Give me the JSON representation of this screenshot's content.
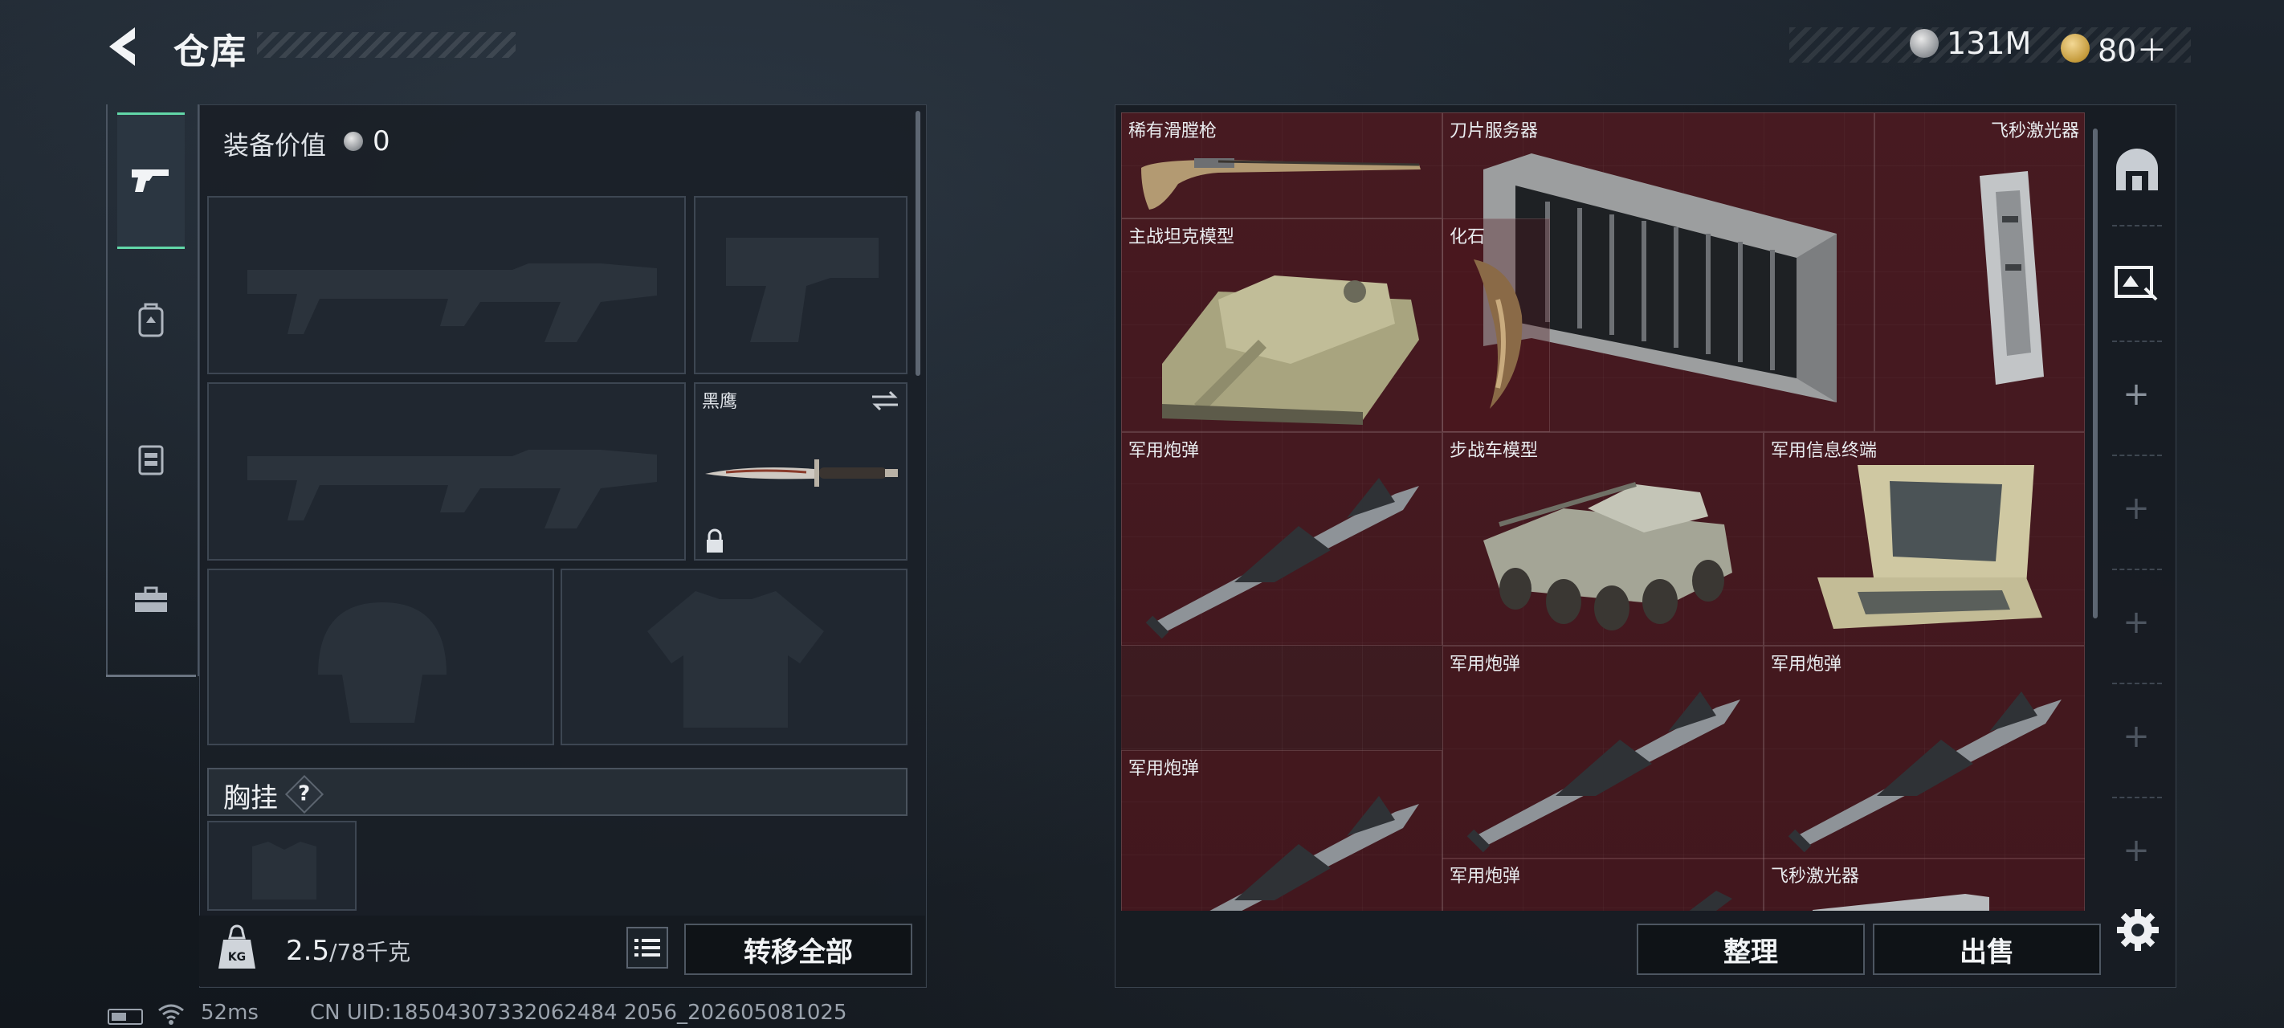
{
  "header": {
    "title": "仓库"
  },
  "currency": {
    "silver": "131M",
    "gold": "80＋"
  },
  "left_tabs": [
    {
      "icon": "pistol-icon",
      "active": true
    },
    {
      "icon": "backpack-icon",
      "active": false
    },
    {
      "icon": "vest-icon",
      "active": false
    },
    {
      "icon": "toolbox-icon",
      "active": false
    }
  ],
  "equipment": {
    "value_label": "装备价值",
    "value": "0",
    "slots": [
      {
        "name": "",
        "item": "rifle-placeholder"
      },
      {
        "name": "",
        "item": "pistol-placeholder"
      },
      {
        "name": "",
        "item": "rifle-placeholder"
      },
      {
        "name": "黑鹰",
        "item": "knife"
      },
      {
        "name": "",
        "item": "helmet-placeholder"
      },
      {
        "name": "",
        "item": "armor-placeholder"
      }
    ],
    "chest_rig_label": "胸挂",
    "help_symbol": "?",
    "weight_current": "2.5",
    "weight_max": "/78千克",
    "transfer_all": "转移全部"
  },
  "status_bar": {
    "ping": "52ms",
    "uid": "CN UID:18504307332062484 2056_202605081025"
  },
  "inventory": {
    "items": [
      {
        "name": "稀有滑膛枪",
        "icon": "musket"
      },
      {
        "name": "刀片服务器",
        "icon": "blade-server"
      },
      {
        "name": "飞秒激光器",
        "icon": "laser-device"
      },
      {
        "name": "主战坦克模型",
        "icon": "tank-model"
      },
      {
        "name": "化石",
        "icon": "fossil-claw"
      },
      {
        "name": "步战车模型",
        "icon": "ifv-model"
      },
      {
        "name": "军用信息终端",
        "icon": "military-terminal"
      },
      {
        "name": "军用炮弹",
        "icon": "missile"
      },
      {
        "name": "军用炮弹",
        "icon": "missile"
      },
      {
        "name": "军用炮弹",
        "icon": "missile"
      },
      {
        "name": "军用炮弹",
        "icon": "missile"
      },
      {
        "name": "军用炮弹",
        "icon": "missile"
      },
      {
        "name": "飞秒激光器",
        "icon": "laser-device"
      }
    ],
    "sort_label": "整理",
    "sell_label": "出售"
  }
}
